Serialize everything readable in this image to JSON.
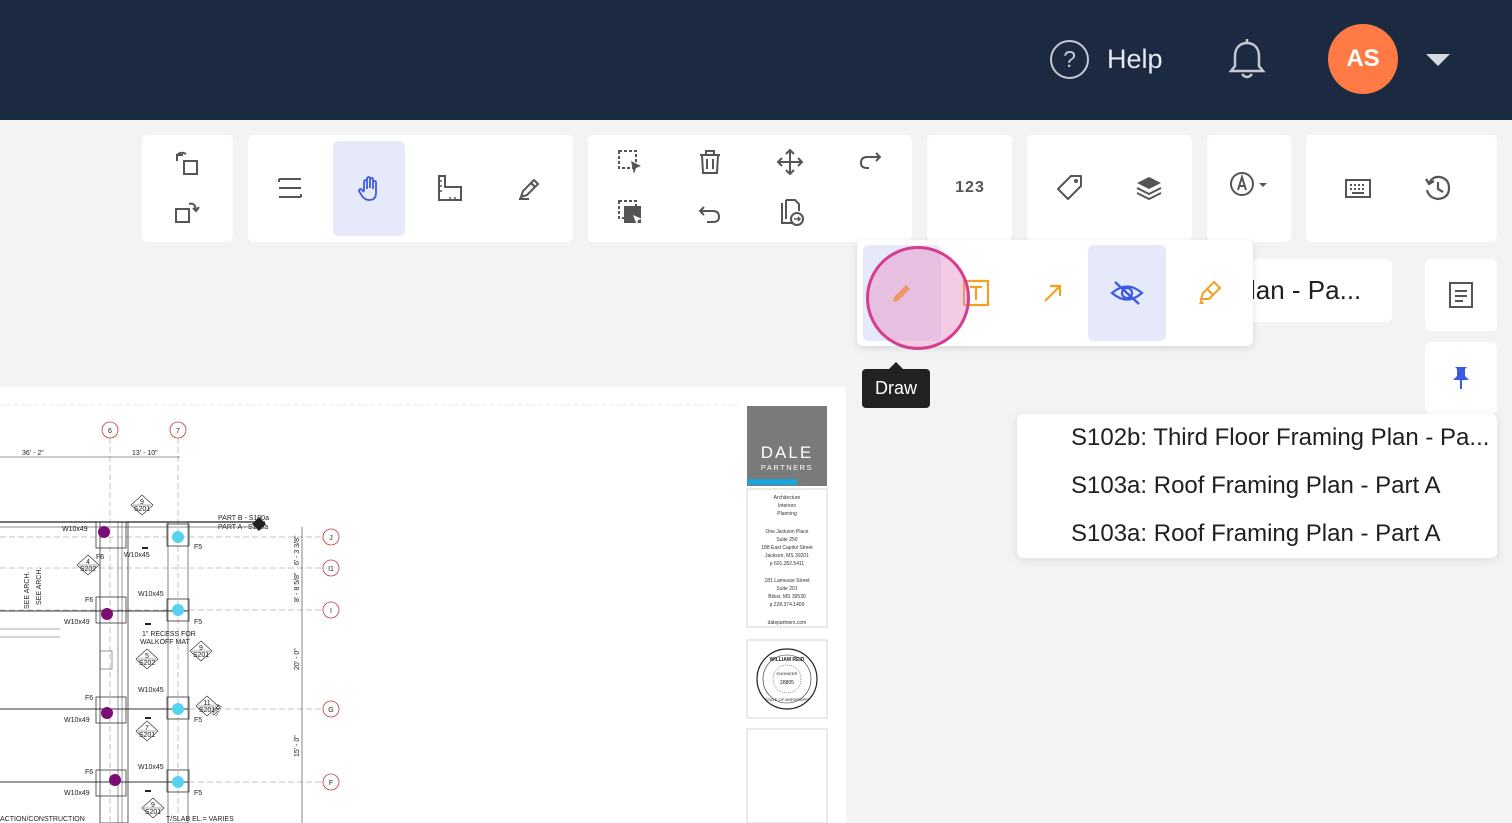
{
  "header": {
    "help_label": "Help",
    "avatar_initials": "AS"
  },
  "toolbar": {
    "count_label": "123"
  },
  "popup": {
    "tooltip": "Draw"
  },
  "sheet": {
    "current_partial": "lan - Pa..."
  },
  "dropdown": {
    "items": [
      {
        "label": "S102b: Third Floor Framing Plan - Pa..."
      },
      {
        "label": "S103a: Roof Framing Plan - Part A"
      },
      {
        "label": "S103a: Roof Framing Plan - Part A"
      }
    ]
  },
  "drawing": {
    "grid_cols": [
      "6",
      "7"
    ],
    "grid_rows": [
      "J",
      "I1",
      "I",
      "G",
      "F"
    ],
    "dims_top": [
      "36' - 2\"",
      "13' - 10\""
    ],
    "dims_side": [
      "6' - 3 3/8\"",
      "8' - 8 5/8\"",
      "20' - 0\"",
      "15' - 0\""
    ],
    "beams": [
      "W10x49",
      "W10x45",
      "W10x45",
      "W10x49",
      "W10x45",
      "W10x49",
      "W10x45",
      "W10x49",
      "W10x45",
      "W10x49"
    ],
    "footings": [
      "F6",
      "F5",
      "F6",
      "F5",
      "F6",
      "F5",
      "F6",
      "F5",
      "F5"
    ],
    "note_recess": "1\" RECESS FOR",
    "note_walkoff": "WALKOFF MAT",
    "see_arch_1": "SEE ARCH.",
    "see_arch_2": "SEE ARCH.",
    "part_b": "PART B - S100a",
    "part_a": "PART A - S100a",
    "slab_note": "T/SLAB EL.= VARIES",
    "bottom_left_note": "ACTION/CONSTRUCTION",
    "sim_label": "SIM",
    "callouts": [
      {
        "num": "9",
        "sheet": "S201"
      },
      {
        "num": "4",
        "sheet": "S202"
      },
      {
        "num": "5",
        "sheet": "S202"
      },
      {
        "num": "9",
        "sheet": "S201"
      },
      {
        "num": "11",
        "sheet": "S201"
      },
      {
        "num": "7",
        "sheet": "S201"
      },
      {
        "num": "9",
        "sheet": "S201"
      }
    ]
  },
  "titleblock": {
    "firm_line1": "DALE",
    "firm_line2": "PARTNERS",
    "disciplines": [
      "Architecture",
      "Interiors",
      "Planning"
    ],
    "address1": [
      "One Jackson Place",
      "Suite 250",
      "188 East Capitol Street",
      "Jackson, MS 39201",
      "p 601.352.5411"
    ],
    "address2": [
      "181 Lameuse Street",
      "Suite 201",
      "Biloxi, MS 39530",
      "p 228.374.1409"
    ],
    "website": "dalepartners.com",
    "seal_name": "WILLIAM REID",
    "seal_word": "ENGINEER",
    "seal_number": "28805",
    "seal_state": "STATE OF MISSISSIPPI"
  },
  "colors": {
    "header_bg": "#1c2a41",
    "avatar_bg": "#ff7a45",
    "active_tool_bg": "#e6e9fa",
    "icon_blue": "#3d5be0",
    "icon_orange": "#f5a020",
    "highlight_ring": "#d63c8f",
    "purple_dot": "#7a0f73",
    "cyan_dot": "#55d3ee",
    "brand_blue": "#1ba4dc"
  }
}
